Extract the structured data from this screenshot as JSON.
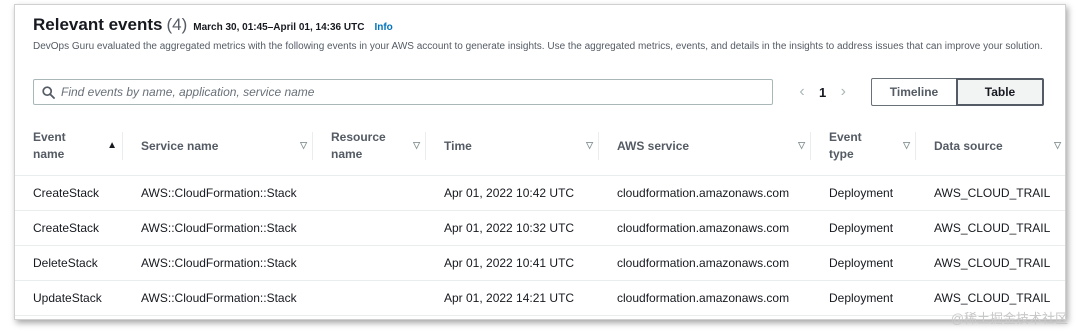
{
  "header": {
    "title": "Relevant events",
    "count": "(4)",
    "date_range": "March 30, 01:45–April 01, 14:36 UTC",
    "info": "Info",
    "description": "DevOps Guru evaluated the aggregated metrics with the following events in your AWS account to generate insights. Use the aggregated metrics, events, and details in the insights to address issues that can improve your solution."
  },
  "search": {
    "placeholder": "Find events by name, application, service name"
  },
  "pagination": {
    "current_page": "1"
  },
  "view_toggle": {
    "timeline": "Timeline",
    "table": "Table",
    "selected": "Table"
  },
  "table": {
    "columns": [
      {
        "line1": "Event",
        "line2": "name",
        "sort": "ascending"
      },
      {
        "line1": "Service name",
        "line2": "",
        "sort": "none"
      },
      {
        "line1": "Resource",
        "line2": "name",
        "sort": "none"
      },
      {
        "line1": "Time",
        "line2": "",
        "sort": "none"
      },
      {
        "line1": "AWS service",
        "line2": "",
        "sort": "none"
      },
      {
        "line1": "Event",
        "line2": "type",
        "sort": "none"
      },
      {
        "line1": "Data source",
        "line2": "",
        "sort": "none"
      }
    ],
    "rows": [
      [
        "CreateStack",
        "AWS::CloudFormation::Stack",
        "",
        "Apr 01, 2022 10:42 UTC",
        "cloudformation.amazonaws.com",
        "Deployment",
        "AWS_CLOUD_TRAIL"
      ],
      [
        "CreateStack",
        "AWS::CloudFormation::Stack",
        "",
        "Apr 01, 2022 10:32 UTC",
        "cloudformation.amazonaws.com",
        "Deployment",
        "AWS_CLOUD_TRAIL"
      ],
      [
        "DeleteStack",
        "AWS::CloudFormation::Stack",
        "",
        "Apr 01, 2022 10:41 UTC",
        "cloudformation.amazonaws.com",
        "Deployment",
        "AWS_CLOUD_TRAIL"
      ],
      [
        "UpdateStack",
        "AWS::CloudFormation::Stack",
        "",
        "Apr 01, 2022 14:21 UTC",
        "cloudformation.amazonaws.com",
        "Deployment",
        "AWS_CLOUD_TRAIL"
      ]
    ]
  },
  "watermark": "@稀土掘金技术社区",
  "colors": {
    "link": "#0073bb",
    "text": "#16191f",
    "secondary_text": "#545b64",
    "border": "#eaeded"
  },
  "icons": {
    "search": "search-icon",
    "prev": "chevron-left-icon",
    "next": "chevron-right-icon",
    "sort_asc": "sort-ascending-icon",
    "sort": "sort-caret-down-icon"
  }
}
